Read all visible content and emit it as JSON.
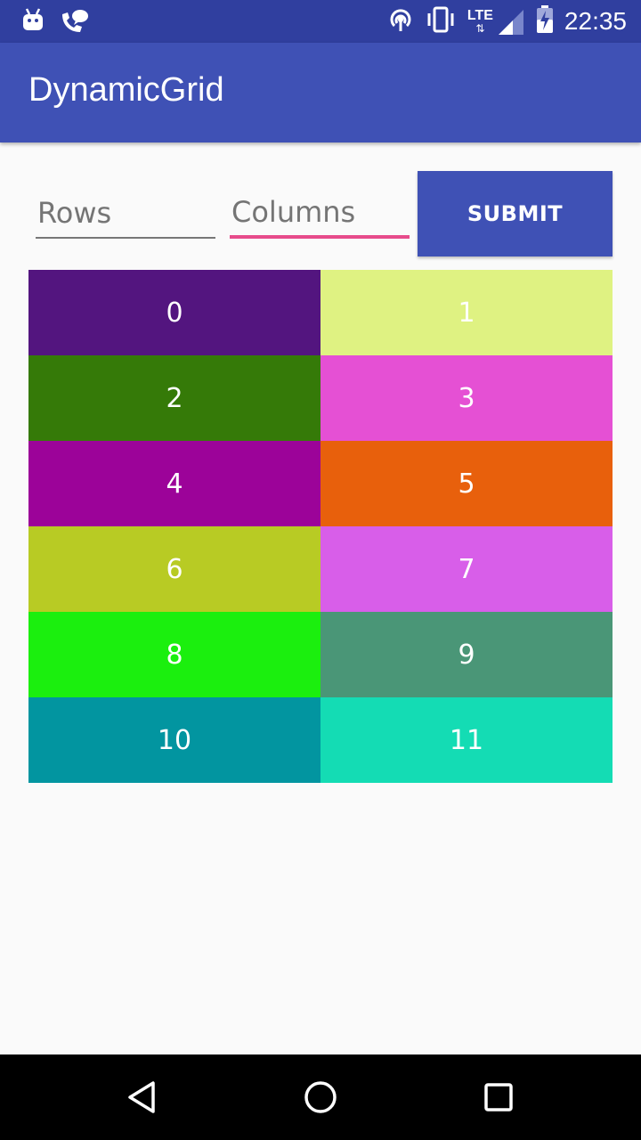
{
  "status_bar": {
    "time": "22:35",
    "network": "LTE",
    "left_icons": [
      "android-icon",
      "chat-phone-icon"
    ],
    "right_icons": [
      "hotspot-icon",
      "vibrate-icon",
      "lte-signal-icon",
      "battery-charging-icon"
    ]
  },
  "app_bar": {
    "title": "DynamicGrid",
    "color": "#3f51b5"
  },
  "form": {
    "rows_placeholder": "Rows",
    "columns_placeholder": "Columns",
    "submit_label": "SUBMIT"
  },
  "grid": {
    "columns": 2,
    "rows": 6,
    "cells": [
      {
        "label": "0",
        "color": "#53157f"
      },
      {
        "label": "1",
        "color": "#dff282"
      },
      {
        "label": "2",
        "color": "#357a08"
      },
      {
        "label": "3",
        "color": "#e550d4"
      },
      {
        "label": "4",
        "color": "#9c0399"
      },
      {
        "label": "5",
        "color": "#e8600c"
      },
      {
        "label": "6",
        "color": "#b8cb24"
      },
      {
        "label": "7",
        "color": "#d85ee9"
      },
      {
        "label": "8",
        "color": "#1bef0e"
      },
      {
        "label": "9",
        "color": "#4a9677"
      },
      {
        "label": "10",
        "color": "#0295a0"
      },
      {
        "label": "11",
        "color": "#14dcb4"
      }
    ]
  },
  "nav_bar": {
    "buttons": [
      "back-icon",
      "home-icon",
      "recents-icon"
    ]
  }
}
